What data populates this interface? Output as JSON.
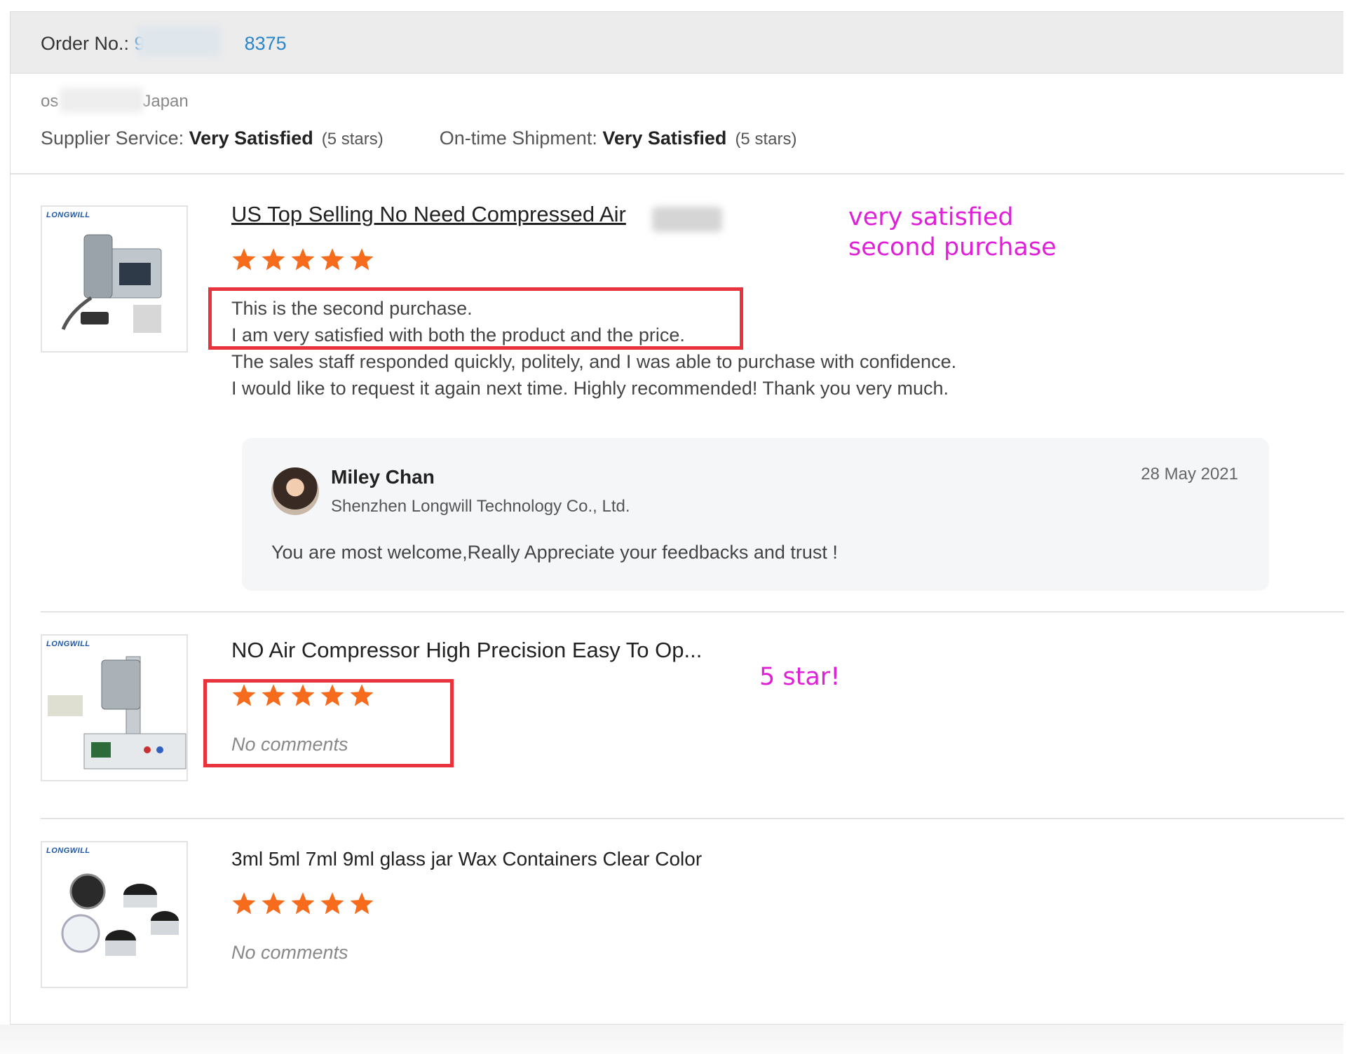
{
  "order": {
    "label": "Order No.: ",
    "number_start": "903",
    "number_end": "8375"
  },
  "buyer": {
    "prefix": "os",
    "country": "Japan"
  },
  "ratings": {
    "supplier_label": "Supplier Service: ",
    "supplier_value": "Very Satisfied",
    "supplier_stars": "(5 stars)",
    "shipment_label": "On-time Shipment: ",
    "shipment_value": "Very Satisfied",
    "shipment_stars": "(5 stars)"
  },
  "reviews": [
    {
      "title": "US Top Selling No Need Compressed Air",
      "rating": 5,
      "text_lines": [
        "This is the second purchase.",
        "I am very satisfied with both the product and the price.",
        "The sales staff responded quickly, politely, and I was able to purchase with confidence.",
        "I would like to request it again next time. Highly recommended! Thank you very much."
      ],
      "brand": "LONGWILL",
      "annotation": [
        "very satisfied",
        "second purchase"
      ]
    },
    {
      "title": "NO Air Compressor High Precision Easy To Op...",
      "rating": 5,
      "comment": "No comments",
      "brand": "LONGWILL",
      "annotation": "5 star!"
    },
    {
      "title": "3ml 5ml 7ml 9ml glass jar Wax Containers Clear Color",
      "rating": 5,
      "comment": "No comments",
      "brand": "LONGWILL"
    }
  ],
  "reply": {
    "name": "Miley Chan",
    "company": "Shenzhen Longwill Technology Co., Ltd.",
    "date": "28 May 2021",
    "text": "You are most welcome,Really Appreciate your feedbacks and trust !"
  },
  "colors": {
    "star": "#f76b1c",
    "link": "#2a86c9",
    "annotation_box": "#e8323c",
    "annotation_text": "#e020d8"
  }
}
